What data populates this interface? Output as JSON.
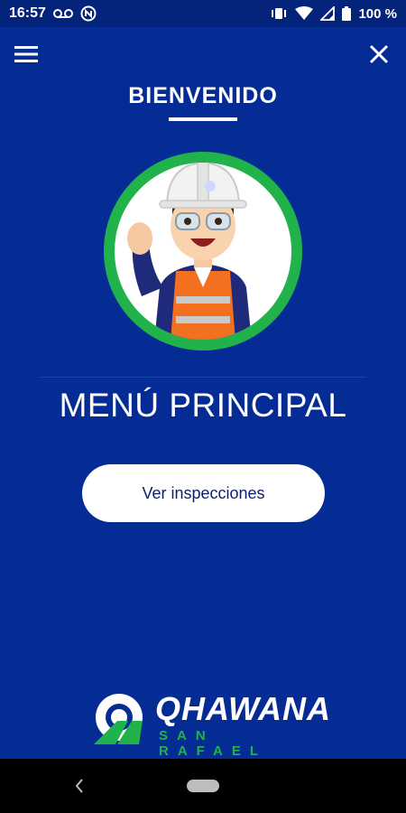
{
  "status_bar": {
    "time": "16:57",
    "battery": "100 %",
    "icons": [
      "voicemail-icon",
      "nfc-icon",
      "vibrate-icon",
      "wifi-icon",
      "signal-icon",
      "battery-icon"
    ]
  },
  "header": {
    "menu_icon": "hamburger-menu-icon",
    "close_icon": "close-icon",
    "welcome": "BIENVENIDO"
  },
  "main": {
    "title": "MENÚ PRINCIPAL",
    "button_label": "Ver inspecciones"
  },
  "brand": {
    "name": "QHAWANA",
    "subtitle": "SAN RAFAEL"
  },
  "colors": {
    "background": "#052c94",
    "avatar_ring": "#22b24c",
    "button_bg": "#ffffff",
    "button_text": "#0b1f6b",
    "brand_green": "#22b24c"
  }
}
